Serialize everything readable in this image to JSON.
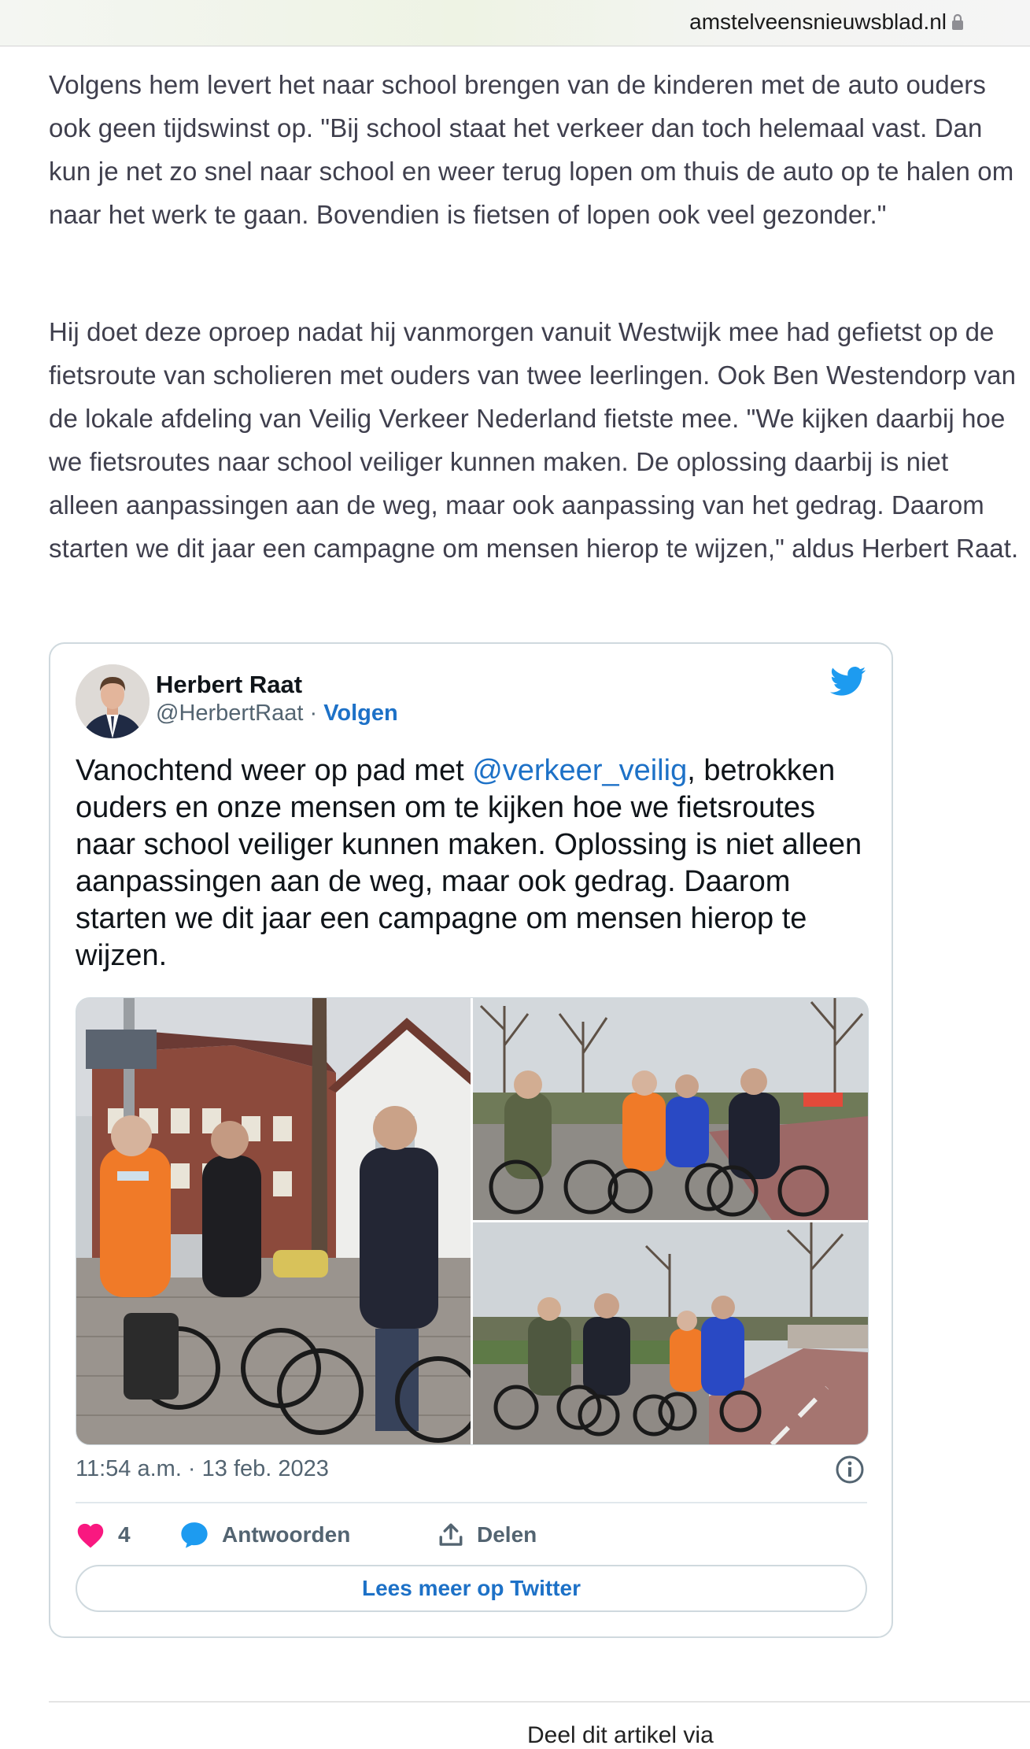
{
  "browser": {
    "url": "amstelveensnieuwsblad.nl",
    "lock_icon": "lock-icon"
  },
  "article": {
    "paragraphs": [
      "Volgens hem levert het naar school brengen van de kinderen met de auto ouders ook geen tijdswinst op. \"Bij school staat het verkeer dan toch helemaal vast. Dan kun je net zo snel naar school en weer terug lopen om thuis de auto op te halen om naar het werk te gaan. Bovendien is fietsen of lopen ook veel gezonder.\"",
      "Hij doet deze oproep nadat hij vanmorgen vanuit Westwijk mee had gefietst op de fietsroute van scholieren met ouders van twee leerlingen. Ook Ben Westendorp van de lokale afdeling van Veilig Verkeer Nederland fietste mee. \"We kijken daarbij hoe we fietsroutes naar school veiliger kunnen maken. De oplossing daarbij is niet alleen aanpassingen aan de weg, maar ook aanpassing van het gedrag. Daarom starten we dit jaar een campagne om mensen hierop te wijzen,\" aldus Herbert Raat."
    ]
  },
  "tweet": {
    "author_name": "Herbert Raat",
    "author_handle": "@HerbertRaat",
    "separator": " · ",
    "follow_label": "Volgen",
    "text_before": "Vanochtend weer op pad met ",
    "mention": "@verkeer_veilig",
    "text_after": ", betrokken ouders en onze mensen om te kijken hoe we fietsroutes naar school veiliger kunnen maken. Oplossing is niet alleen aanpassingen aan de weg, maar ook gedrag. Daarom starten we dit jaar een campagne om mensen hierop te wijzen.",
    "timestamp": "11:54 a.m. · 13 feb. 2023",
    "likes_count": "4",
    "reply_label": "Antwoorden",
    "share_label": "Delen",
    "read_more_label": "Lees meer op Twitter",
    "brand_color": "#1d9bf0",
    "like_color": "#f91880",
    "link_color": "#1d71c7"
  },
  "footer": {
    "share_article_label": "Deel dit artikel via"
  }
}
